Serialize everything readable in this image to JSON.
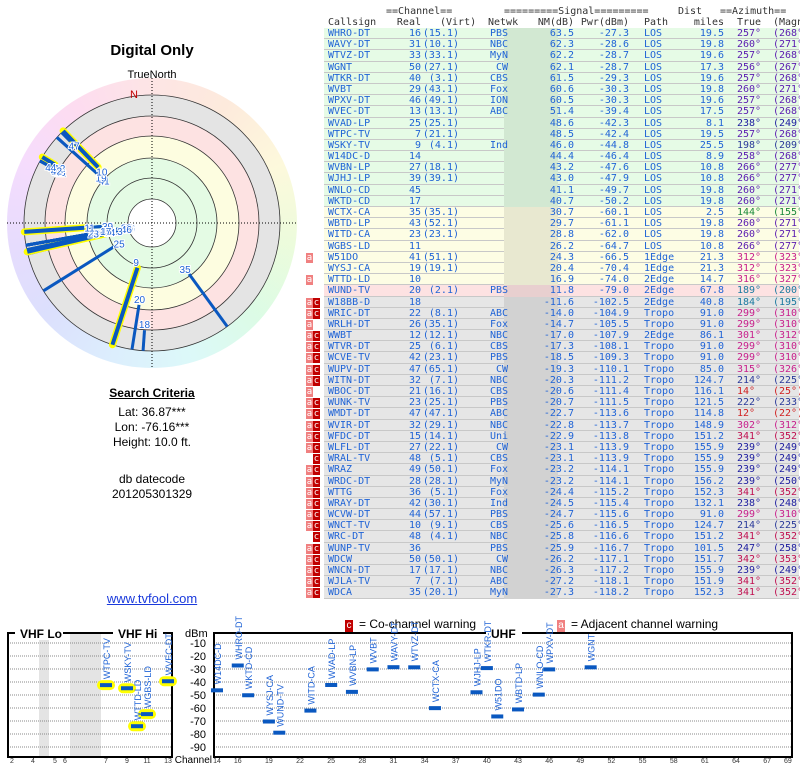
{
  "left": {
    "title": "Digital Only",
    "north_label": "TrueNorth",
    "north_marker": "N",
    "search": {
      "heading": "Search Criteria",
      "lat": "Lat: 36.87***",
      "lon": "Lon: -76.16***",
      "height": "Height: 10.0 ft.",
      "db_label": "db datecode",
      "db_value": "201205301329"
    },
    "link": "www.tvfool.com"
  },
  "table": {
    "group_headers": {
      "channel": "==Channel==",
      "signal": "=========Signal=========",
      "dist": "Dist",
      "azimuth": "==Azimuth=="
    },
    "columns": [
      "Callsign",
      "Real",
      "(Virt)",
      "Netwk",
      "NM(dB)",
      "Pwr(dBm)",
      "Path",
      "miles",
      "True",
      "(Magn)"
    ],
    "rows": [
      [
        "",
        "",
        "WHRO-DT",
        "16",
        "(15.1)",
        "PBS",
        "63.5",
        "-27.3",
        "LOS",
        "19.5",
        "257°",
        "(268°)",
        "g"
      ],
      [
        "",
        "",
        "WAVY-DT",
        "31",
        "(10.1)",
        "NBC",
        "62.3",
        "-28.6",
        "LOS",
        "19.8",
        "260°",
        "(271°)",
        "g"
      ],
      [
        "",
        "",
        "WTVZ-DT",
        "33",
        "(33.1)",
        "MyN",
        "62.2",
        "-28.7",
        "LOS",
        "19.6",
        "257°",
        "(268°)",
        "g"
      ],
      [
        "",
        "",
        "WGNT",
        "50",
        "(27.1)",
        "CW",
        "62.1",
        "-28.7",
        "LOS",
        "17.3",
        "256°",
        "(267°)",
        "g"
      ],
      [
        "",
        "",
        "WTKR-DT",
        "40",
        "(3.1)",
        "CBS",
        "61.5",
        "-29.3",
        "LOS",
        "19.6",
        "257°",
        "(268°)",
        "g"
      ],
      [
        "",
        "",
        "WVBT",
        "29",
        "(43.1)",
        "Fox",
        "60.6",
        "-30.3",
        "LOS",
        "19.8",
        "260°",
        "(271°)",
        "g"
      ],
      [
        "",
        "",
        "WPXV-DT",
        "46",
        "(49.1)",
        "ION",
        "60.5",
        "-30.3",
        "LOS",
        "19.6",
        "257°",
        "(268°)",
        "g"
      ],
      [
        "",
        "",
        "WVEC-DT",
        "13",
        "(13.1)",
        "ABC",
        "51.4",
        "-39.4",
        "LOS",
        "17.5",
        "257°",
        "(268°)",
        "g"
      ],
      [
        "",
        "",
        "WVAD-LP",
        "25",
        "(25.1)",
        "",
        "48.6",
        "-42.3",
        "LOS",
        "8.1",
        "238°",
        "(249°)",
        "g"
      ],
      [
        "",
        "",
        "WTPC-TV",
        "7",
        "(21.1)",
        "",
        "48.5",
        "-42.4",
        "LOS",
        "19.5",
        "257°",
        "(268°)",
        "g"
      ],
      [
        "",
        "",
        "WSKY-TV",
        "9",
        "(4.1)",
        "Ind",
        "46.0",
        "-44.8",
        "LOS",
        "25.5",
        "198°",
        "(209°)",
        "g"
      ],
      [
        "",
        "",
        "W14DC-D",
        "14",
        "",
        "",
        "44.4",
        "-46.4",
        "LOS",
        "8.9",
        "258°",
        "(268°)",
        "g"
      ],
      [
        "",
        "",
        "WVBN-LP",
        "27",
        "(18.1)",
        "",
        "43.2",
        "-47.6",
        "LOS",
        "10.8",
        "266°",
        "(277°)",
        "g"
      ],
      [
        "",
        "",
        "WJHJ-LP",
        "39",
        "(39.1)",
        "",
        "43.0",
        "-47.9",
        "LOS",
        "10.8",
        "266°",
        "(277°)",
        "g"
      ],
      [
        "",
        "",
        "WNLO-CD",
        "45",
        "",
        "",
        "41.1",
        "-49.7",
        "LOS",
        "19.8",
        "260°",
        "(271°)",
        "g"
      ],
      [
        "",
        "",
        "WKTD-CD",
        "17",
        "",
        "",
        "40.7",
        "-50.2",
        "LOS",
        "19.8",
        "260°",
        "(271°)",
        "g"
      ],
      [
        "",
        "",
        "WCTX-CA",
        "35",
        "(35.1)",
        "",
        "30.7",
        "-60.1",
        "LOS",
        "2.5",
        "144°",
        "(155°)",
        "y"
      ],
      [
        "",
        "",
        "WBTD-LP",
        "43",
        "(52.1)",
        "",
        "29.7",
        "-61.1",
        "LOS",
        "19.8",
        "260°",
        "(271°)",
        "y"
      ],
      [
        "",
        "",
        "WITD-CA",
        "23",
        "(23.1)",
        "",
        "28.8",
        "-62.0",
        "LOS",
        "19.8",
        "260°",
        "(271°)",
        "y"
      ],
      [
        "",
        "",
        "WGBS-LD",
        "11",
        "",
        "",
        "26.2",
        "-64.7",
        "LOS",
        "10.8",
        "266°",
        "(277°)",
        "y"
      ],
      [
        "a",
        "",
        "W51DO",
        "41",
        "(51.1)",
        "",
        "24.3",
        "-66.5",
        "1Edge",
        "21.3",
        "312°",
        "(323°)",
        "y"
      ],
      [
        "",
        "",
        "WYSJ-CA",
        "19",
        "(19.1)",
        "",
        "20.4",
        "-70.4",
        "1Edge",
        "21.3",
        "312°",
        "(323°)",
        "y"
      ],
      [
        "a",
        "",
        "WTTD-LD",
        "10",
        "",
        "",
        "16.9",
        "-74.0",
        "2Edge",
        "14.7",
        "316°",
        "(327°)",
        "y"
      ],
      [
        "",
        "",
        "WUND-TV",
        "20",
        "(2.1)",
        "PBS",
        "11.8",
        "-79.0",
        "2Edge",
        "67.8",
        "189°",
        "(200°)",
        "p"
      ],
      [
        "a",
        "c",
        "W18BB-D",
        "18",
        "",
        "",
        "-11.6",
        "-102.5",
        "2Edge",
        "40.8",
        "184°",
        "(195°)",
        "n"
      ],
      [
        "a",
        "c",
        "WRIC-DT",
        "22",
        "(8.1)",
        "ABC",
        "-14.0",
        "-104.9",
        "Tropo",
        "91.0",
        "299°",
        "(310°)",
        "n"
      ],
      [
        "a",
        "",
        "WRLH-DT",
        "26",
        "(35.1)",
        "Fox",
        "-14.7",
        "-105.5",
        "Tropo",
        "91.0",
        "299°",
        "(310°)",
        "n"
      ],
      [
        "a",
        "c",
        "WWBT",
        "12",
        "(12.1)",
        "NBC",
        "-17.0",
        "-107.9",
        "2Edge",
        "86.1",
        "301°",
        "(312°)",
        "n"
      ],
      [
        "a",
        "c",
        "WTVR-DT",
        "25",
        "(6.1)",
        "CBS",
        "-17.3",
        "-108.1",
        "Tropo",
        "91.0",
        "299°",
        "(310°)",
        "n"
      ],
      [
        "a",
        "c",
        "WCVE-TV",
        "42",
        "(23.1)",
        "PBS",
        "-18.5",
        "-109.3",
        "Tropo",
        "91.0",
        "299°",
        "(310°)",
        "n"
      ],
      [
        "a",
        "c",
        "WUPV-DT",
        "47",
        "(65.1)",
        "CW",
        "-19.3",
        "-110.1",
        "Tropo",
        "85.0",
        "315°",
        "(326°)",
        "n"
      ],
      [
        "a",
        "c",
        "WITN-DT",
        "32",
        "(7.1)",
        "NBC",
        "-20.3",
        "-111.2",
        "Tropo",
        "124.7",
        "214°",
        "(225°)",
        "n"
      ],
      [
        "a",
        "",
        "WBOC-DT",
        "21",
        "(16.1)",
        "CBS",
        "-20.6",
        "-111.4",
        "Tropo",
        "116.1",
        "14°",
        "(25°)",
        "n"
      ],
      [
        "a",
        "c",
        "WUNK-TV",
        "23",
        "(25.1)",
        "PBS",
        "-20.7",
        "-111.5",
        "Tropo",
        "121.5",
        "222°",
        "(233°)",
        "n"
      ],
      [
        "a",
        "c",
        "WMDT-DT",
        "47",
        "(47.1)",
        "ABC",
        "-22.7",
        "-113.6",
        "Tropo",
        "114.8",
        "12°",
        "(22°)",
        "n"
      ],
      [
        "a",
        "c",
        "WVIR-DT",
        "32",
        "(29.1)",
        "NBC",
        "-22.8",
        "-113.7",
        "Tropo",
        "148.9",
        "302°",
        "(312°)",
        "n"
      ],
      [
        "a",
        "c",
        "WFDC-DT",
        "15",
        "(14.1)",
        "Uni",
        "-22.9",
        "-113.8",
        "Tropo",
        "151.2",
        "341°",
        "(352°)",
        "n"
      ],
      [
        "a",
        "c",
        "WLFL-DT",
        "27",
        "(22.1)",
        "CW",
        "-23.1",
        "-113.9",
        "Tropo",
        "155.9",
        "239°",
        "(249°)",
        "n"
      ],
      [
        "",
        "c",
        "WRAL-TV",
        "48",
        "(5.1)",
        "CBS",
        "-23.1",
        "-113.9",
        "Tropo",
        "155.9",
        "239°",
        "(249°)",
        "n"
      ],
      [
        "a",
        "c",
        "WRAZ",
        "49",
        "(50.1)",
        "Fox",
        "-23.2",
        "-114.1",
        "Tropo",
        "155.9",
        "239°",
        "(249°)",
        "n"
      ],
      [
        "a",
        "c",
        "WRDC-DT",
        "28",
        "(28.1)",
        "MyN",
        "-23.2",
        "-114.1",
        "Tropo",
        "156.2",
        "239°",
        "(250°)",
        "n"
      ],
      [
        "a",
        "c",
        "WTTG",
        "36",
        "(5.1)",
        "Fox",
        "-24.4",
        "-115.2",
        "Tropo",
        "152.3",
        "341°",
        "(352°)",
        "n"
      ],
      [
        "a",
        "c",
        "WRAY-DT",
        "42",
        "(30.1)",
        "Ind",
        "-24.5",
        "-115.4",
        "Tropo",
        "132.1",
        "238°",
        "(248°)",
        "n"
      ],
      [
        "a",
        "c",
        "WCVW-DT",
        "44",
        "(57.1)",
        "PBS",
        "-24.7",
        "-115.6",
        "Tropo",
        "91.0",
        "299°",
        "(310°)",
        "n"
      ],
      [
        "a",
        "c",
        "WNCT-TV",
        "10",
        "(9.1)",
        "CBS",
        "-25.6",
        "-116.5",
        "Tropo",
        "124.7",
        "214°",
        "(225°)",
        "n"
      ],
      [
        "",
        "c",
        "WRC-DT",
        "48",
        "(4.1)",
        "NBC",
        "-25.8",
        "-116.6",
        "Tropo",
        "151.2",
        "341°",
        "(352°)",
        "n"
      ],
      [
        "a",
        "c",
        "WUNP-TV",
        "36",
        "",
        "PBS",
        "-25.9",
        "-116.7",
        "Tropo",
        "101.5",
        "247°",
        "(258°)",
        "n"
      ],
      [
        "a",
        "c",
        "WDCW",
        "50",
        "(50.1)",
        "CW",
        "-26.2",
        "-117.1",
        "Tropo",
        "151.7",
        "342°",
        "(353°)",
        "n"
      ],
      [
        "a",
        "c",
        "WNCN-DT",
        "17",
        "(17.1)",
        "NBC",
        "-26.3",
        "-117.2",
        "Tropo",
        "155.9",
        "239°",
        "(249°)",
        "n"
      ],
      [
        "a",
        "c",
        "WJLA-TV",
        "7",
        "(7.1)",
        "ABC",
        "-27.2",
        "-118.1",
        "Tropo",
        "151.9",
        "341°",
        "(352°)",
        "n"
      ],
      [
        "a",
        "c",
        "WDCA",
        "35",
        "(20.1)",
        "MyN",
        "-27.3",
        "-118.2",
        "Tropo",
        "152.3",
        "341°",
        "(352°)",
        "n"
      ]
    ]
  },
  "legend": {
    "co_flag": "c",
    "co_text": "= Co-channel warning",
    "adj_flag": "a",
    "adj_text": "= Adjacent channel warning"
  },
  "spectrum": {
    "vhf_lo": "VHF Lo",
    "vhf_hi": "VHF Hi",
    "uhf": "UHF",
    "unit": "dBm",
    "channel_label": "Channel",
    "y_ticks": [
      "-10",
      "-20",
      "-30",
      "-40",
      "-50",
      "-60",
      "-70",
      "-80",
      "-90"
    ],
    "vhf_ticks": [
      "2",
      "4",
      "5",
      "6",
      "7",
      "9",
      "11",
      "13"
    ],
    "uhf_ticks": [
      "14",
      "16",
      "19",
      "22",
      "25",
      "28",
      "31",
      "34",
      "37",
      "40",
      "43",
      "46",
      "49",
      "52",
      "55",
      "58",
      "61",
      "64",
      "67",
      "69"
    ]
  },
  "colors": {
    "text": "#1f63d6",
    "green_row": "#e6fbe6",
    "yellow_row": "#fdfde4",
    "pink_row": "#fde2e2",
    "grey_row": "#e6e6e6",
    "vhf_highlight": "#ffff00",
    "co_flag": "#c00000",
    "adj_flag": "#f08080"
  }
}
